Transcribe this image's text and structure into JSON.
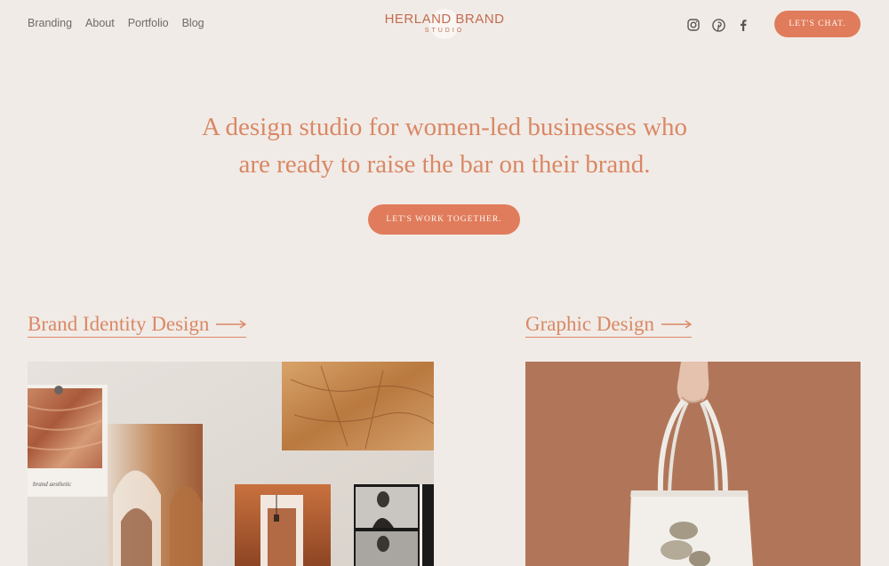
{
  "nav": {
    "items": [
      "Branding",
      "About",
      "Portfolio",
      "Blog"
    ]
  },
  "logo": {
    "main": "HERLAND BRAND",
    "sub": "STUDIO"
  },
  "social": {
    "icons": [
      "instagram-icon",
      "pinterest-icon",
      "facebook-icon"
    ]
  },
  "header": {
    "chat_label": "LET'S CHAT."
  },
  "hero": {
    "line1": "A design studio for women-led businesses who",
    "line2": "are ready to raise the bar on their brand.",
    "cta_label": "LET'S WORK TOGETHER."
  },
  "sections": {
    "left_title": "Brand Identity Design",
    "right_title": "Graphic Design"
  },
  "moodboard": {
    "polaroid_caption": "brand aesthetic"
  },
  "colors": {
    "background": "#f1ebe7",
    "accent": "#e07c5c",
    "heading": "#d98865",
    "nav_text": "#6e6a67",
    "tote_backdrop": "#ae7458"
  }
}
